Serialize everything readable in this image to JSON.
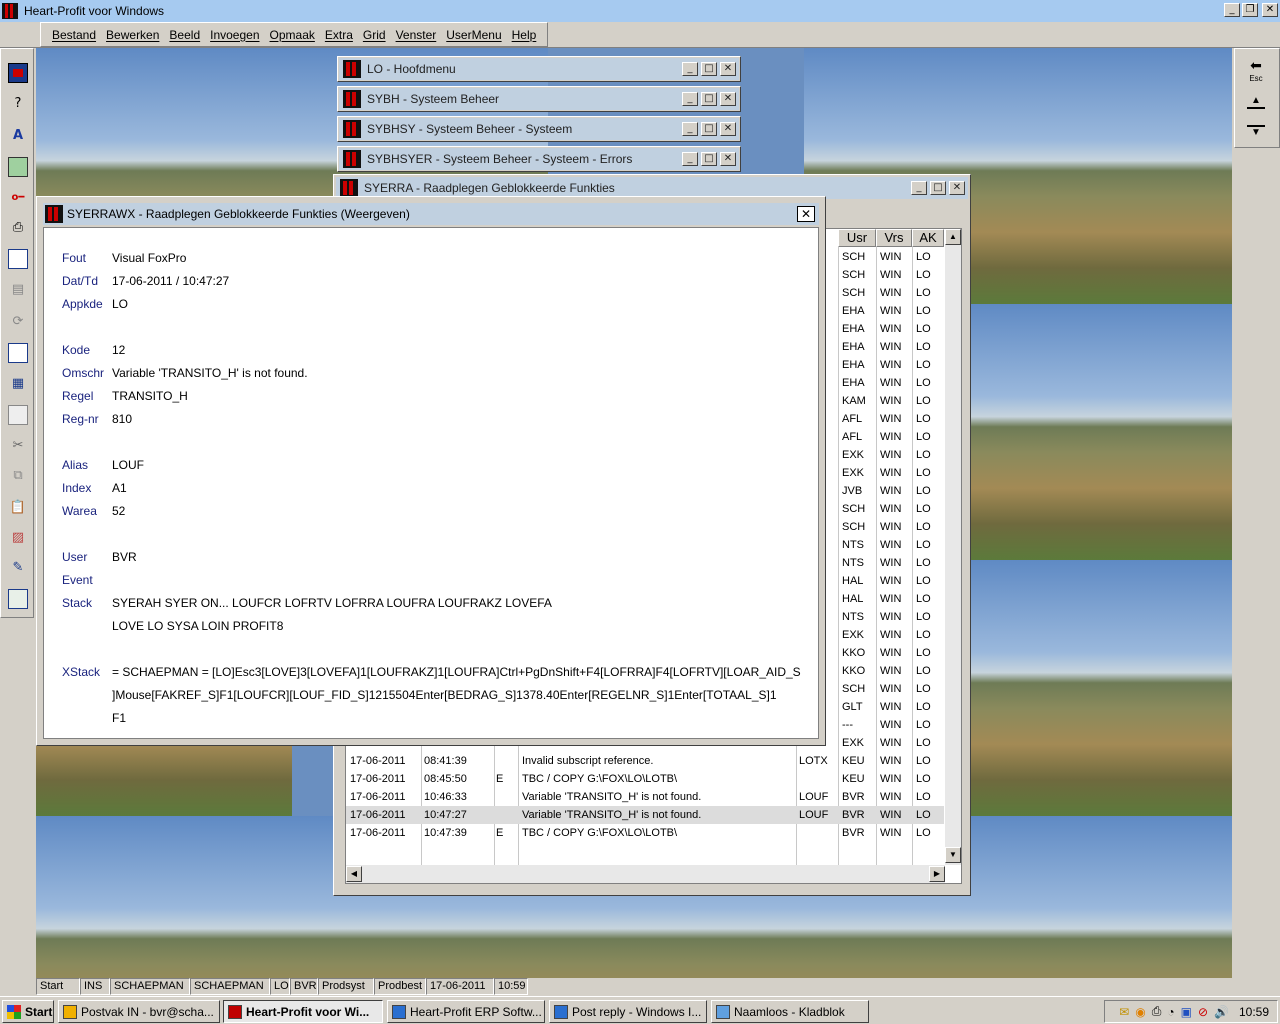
{
  "app_title": "Heart-Profit voor Windows",
  "window_controls": {
    "minimize": "_",
    "restore": "❐",
    "close": "✕"
  },
  "menu": [
    "Bestand",
    "Bewerken",
    "Beeld",
    "Invoegen",
    "Opmaak",
    "Extra",
    "Grid",
    "Venster",
    "UserMenu",
    "Help"
  ],
  "mdi_windows": [
    {
      "title": "LO - Hoofdmenu"
    },
    {
      "title": "SYBH - Systeem Beheer"
    },
    {
      "title": "SYBHSY - Systeem Beheer - Systeem"
    },
    {
      "title": "SYBHSYER - Systeem Beheer - Systeem - Errors"
    },
    {
      "title": "SYERRA - Raadplegen Geblokkeerde Funkties"
    }
  ],
  "grid": {
    "headers": {
      "usr": "Usr",
      "vrs": "Vrs",
      "ak": "AK"
    },
    "right_rows": [
      [
        "SCH",
        "WIN",
        "LO"
      ],
      [
        "SCH",
        "WIN",
        "LO"
      ],
      [
        "SCH",
        "WIN",
        "LO"
      ],
      [
        "EHA",
        "WIN",
        "LO"
      ],
      [
        "EHA",
        "WIN",
        "LO"
      ],
      [
        "EHA",
        "WIN",
        "LO"
      ],
      [
        "EHA",
        "WIN",
        "LO"
      ],
      [
        "EHA",
        "WIN",
        "LO"
      ],
      [
        "KAM",
        "WIN",
        "LO"
      ],
      [
        "AFL",
        "WIN",
        "LO"
      ],
      [
        "AFL",
        "WIN",
        "LO"
      ],
      [
        "EXK",
        "WIN",
        "LO"
      ],
      [
        "EXK",
        "WIN",
        "LO"
      ],
      [
        "JVB",
        "WIN",
        "LO"
      ],
      [
        "SCH",
        "WIN",
        "LO"
      ],
      [
        "SCH",
        "WIN",
        "LO"
      ],
      [
        "NTS",
        "WIN",
        "LO"
      ],
      [
        "NTS",
        "WIN",
        "LO"
      ],
      [
        "HAL",
        "WIN",
        "LO"
      ],
      [
        "HAL",
        "WIN",
        "LO"
      ],
      [
        "NTS",
        "WIN",
        "LO"
      ],
      [
        "EXK",
        "WIN",
        "LO"
      ],
      [
        "KKO",
        "WIN",
        "LO"
      ],
      [
        "KKO",
        "WIN",
        "LO"
      ],
      [
        "SCH",
        "WIN",
        "LO"
      ],
      [
        "GLT",
        "WIN",
        "LO"
      ],
      [
        "---",
        "WIN",
        "LO"
      ],
      [
        "EXK",
        "WIN",
        "LO"
      ]
    ],
    "full_rows": [
      {
        "date": "17-06-2011",
        "time": "08:41:39",
        "type": "",
        "desc": "Invalid subscript reference.",
        "alias": "LOTX",
        "usr": "KEU",
        "vrs": "WIN",
        "ak": "LO"
      },
      {
        "date": "17-06-2011",
        "time": "08:45:50",
        "type": "E",
        "desc": "TBC / COPY G:\\FOX\\LO\\LOTB\\",
        "alias": "",
        "usr": "KEU",
        "vrs": "WIN",
        "ak": "LO"
      },
      {
        "date": "17-06-2011",
        "time": "10:46:33",
        "type": "",
        "desc": "Variable 'TRANSITO_H' is not found.",
        "alias": "LOUF",
        "usr": "BVR",
        "vrs": "WIN",
        "ak": "LO"
      },
      {
        "date": "17-06-2011",
        "time": "10:47:27",
        "type": "",
        "desc": "Variable 'TRANSITO_H' is not found.",
        "alias": "LOUF",
        "usr": "BVR",
        "vrs": "WIN",
        "ak": "LO",
        "selected": true
      },
      {
        "date": "17-06-2011",
        "time": "10:47:39",
        "type": "E",
        "desc": "TBC / COPY G:\\FOX\\LO\\LOTB\\",
        "alias": "",
        "usr": "BVR",
        "vrs": "WIN",
        "ak": "LO"
      }
    ]
  },
  "dialog": {
    "title": "SYERRAWX - Raadplegen Geblokkeerde Funkties (Weergeven)",
    "fields": [
      {
        "label": "Fout",
        "value": "Visual FoxPro"
      },
      {
        "label": "Dat/Td",
        "value": "17-06-2011 / 10:47:27"
      },
      {
        "label": "Appkde",
        "value": "LO"
      },
      {
        "label": "Kode",
        "value": "12"
      },
      {
        "label": "Omschr",
        "value": "Variable 'TRANSITO_H' is not found."
      },
      {
        "label": "Regel",
        "value": " TRANSITO_H"
      },
      {
        "label": "Reg-nr",
        "value": "810"
      },
      {
        "label": "Alias",
        "value": "LOUF"
      },
      {
        "label": "Index",
        "value": "A1"
      },
      {
        "label": "Warea",
        "value": "52"
      },
      {
        "label": "User",
        "value": "BVR"
      },
      {
        "label": "Event",
        "value": ""
      },
      {
        "label": "Stack",
        "value": "SYERAH  SYER  ON...  LOUFCR  LOFRTV  LOFRRA  LOUFRA  LOUFRAKZ  LOVEFA"
      },
      {
        "label": "",
        "value": " LOVE  LO  SYSA  LOIN  PROFIT8"
      },
      {
        "label": "XStack",
        "value": "  = SCHAEPMAN = [LO]Esc3[LOVE]3[LOVEFA]1[LOUFRAKZ]1[LOUFRA]Ctrl+PgDnShift+F4[LOFRRA]F4[LOFRTV][LOAR_AID_S"
      },
      {
        "label": "",
        "value": "]Mouse[FAKREF_S]F1[LOUFCR][LOUF_FID_S]1215504Enter[BEDRAG_S]1378.40Enter[REGELNR_S]1Enter[TOTAAL_S]1"
      },
      {
        "label": "",
        "value": " F1"
      }
    ]
  },
  "statusbar": [
    "Start",
    "INS",
    "SCHAEPMAN",
    "SCHAEPMAN",
    "LO",
    "BVR",
    "Prodsyst",
    "Prodbest",
    "17-06-2011",
    "10:59"
  ],
  "taskbar": {
    "start": "Start",
    "items": [
      {
        "label": "Postvak IN - bvr@scha...",
        "icon": "outlook-icon",
        "color": "#f0b000"
      },
      {
        "label": "Heart-Profit voor Wi...",
        "icon": "heart-profit-icon",
        "color": "#c00000",
        "active": true
      },
      {
        "label": "Heart-Profit ERP Softw...",
        "icon": "ie-icon",
        "color": "#2a6fd0"
      },
      {
        "label": "Post reply - Windows I...",
        "icon": "ie-icon",
        "color": "#2a6fd0"
      },
      {
        "label": "Naamloos - Kladblok",
        "icon": "notepad-icon",
        "color": "#60a0e0"
      }
    ],
    "clock": "10:59"
  },
  "right_toolbar": {
    "esc_label": "Esc"
  }
}
